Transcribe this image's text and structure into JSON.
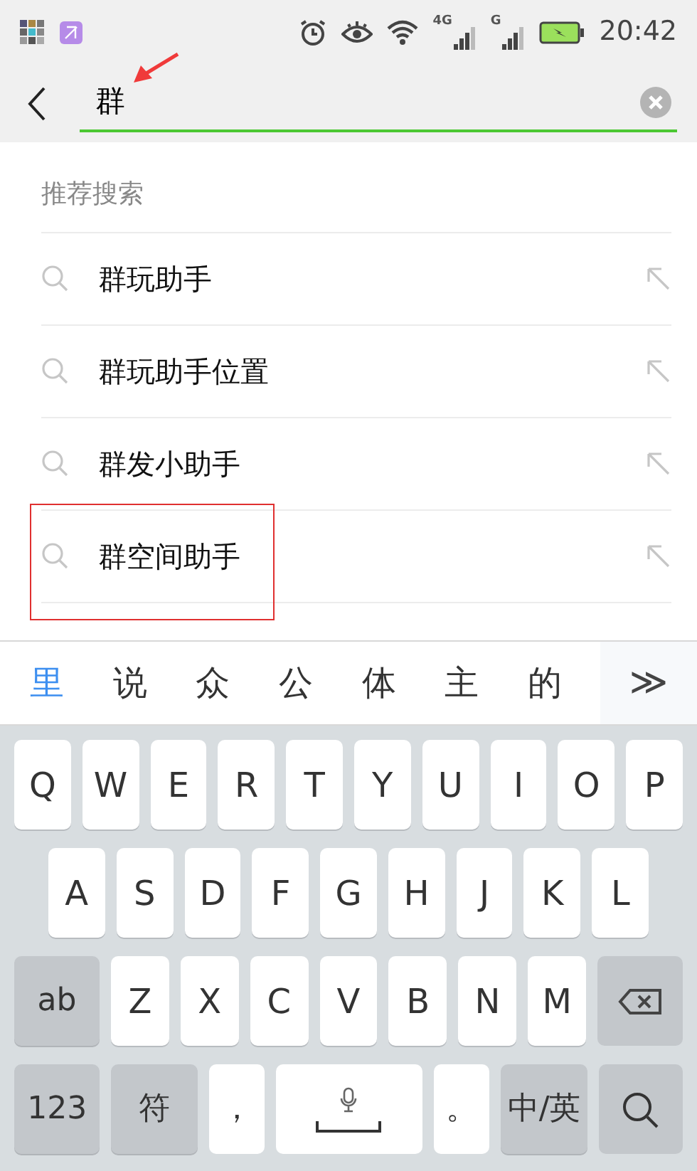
{
  "status_bar": {
    "time": "20:42",
    "network_1": "4G",
    "network_2": "G"
  },
  "search": {
    "value": "群"
  },
  "suggestions": {
    "header": "推荐搜索",
    "items": [
      {
        "text": "群玩助手",
        "highlighted": false
      },
      {
        "text": "群玩助手位置",
        "highlighted": false
      },
      {
        "text": "群发小助手",
        "highlighted": false
      },
      {
        "text": "群空间助手",
        "highlighted": true
      }
    ]
  },
  "candidates": [
    {
      "text": "里",
      "selected": true
    },
    {
      "text": "说",
      "selected": false
    },
    {
      "text": "众",
      "selected": false
    },
    {
      "text": "公",
      "selected": false
    },
    {
      "text": "体",
      "selected": false
    },
    {
      "text": "主",
      "selected": false
    },
    {
      "text": "的",
      "selected": false
    }
  ],
  "more_candidates": "≫",
  "keyboard": {
    "rows": [
      {
        "keys": [
          "Q",
          "W",
          "E",
          "R",
          "T",
          "Y",
          "U",
          "I",
          "O",
          "P"
        ]
      },
      {
        "keys": [
          "A",
          "S",
          "D",
          "F",
          "G",
          "H",
          "J",
          "K",
          "L"
        ]
      },
      {
        "keys": [
          {
            "kind": "func",
            "text": "ab"
          },
          "Z",
          "X",
          "C",
          "V",
          "B",
          "N",
          "M",
          {
            "kind": "backspace"
          }
        ]
      },
      {
        "keys": [
          {
            "kind": "func",
            "text": "123"
          },
          {
            "kind": "func",
            "text": "符"
          },
          {
            "kind": "key",
            "text": "，"
          },
          {
            "kind": "space"
          },
          {
            "kind": "key",
            "text": "。"
          },
          {
            "kind": "func",
            "text": "中/英"
          },
          {
            "kind": "search"
          }
        ]
      }
    ]
  }
}
